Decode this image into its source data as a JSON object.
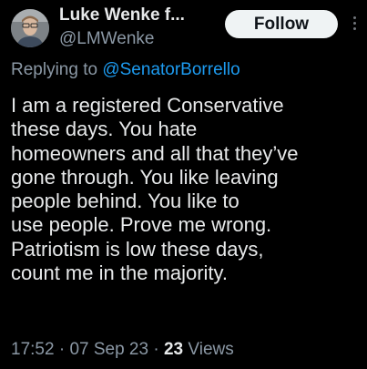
{
  "author": {
    "display_name": "Luke Wenke f...",
    "handle": "@LMWenke"
  },
  "follow_label": "Follow",
  "reply_context": {
    "prefix": "Replying to ",
    "mention": "@SenatorBorrello"
  },
  "tweet": {
    "text": "I am a registered Conservative\nthese days.  You hate\nhomeowners and all that they’ve\ngone through.  You like leaving\npeople behind.  You like to\nuse people.  Prove me wrong.\nPatriotism is low these days,\ncount me in the majority."
  },
  "meta": {
    "time": "17:52",
    "separator": " · ",
    "date": "07 Sep 23",
    "views_count": "23",
    "views_label": " Views"
  },
  "icons": {
    "avatar": "profile-photo",
    "more": "more-options-icon"
  },
  "colors": {
    "background": "#000000",
    "text": "#e7e9ea",
    "secondary_text": "#8b98a5",
    "link": "#1d9bf0",
    "button_background": "#eff3f4"
  }
}
